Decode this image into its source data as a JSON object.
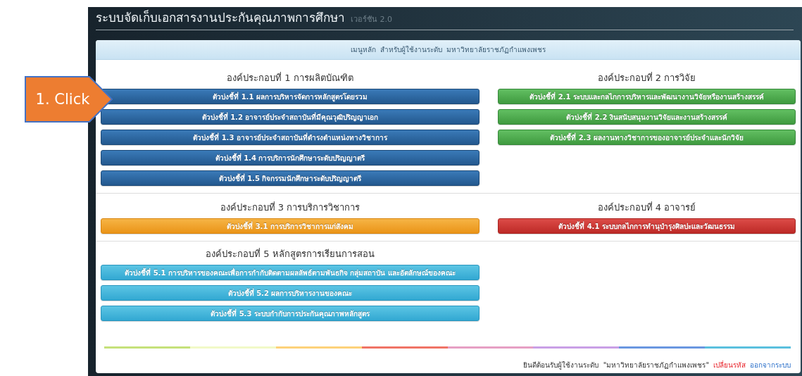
{
  "window": {
    "title": "ระบบจัดเก็บเอกสารงานประกันคุณภาพการศึกษา",
    "version": "เวอร์ชัน 2.0"
  },
  "menu_header": "เมนูหลัก  สำหรับผู้ใช้งานระดับ  มหาวิทยาลัยราชภัฏกำแพงเพชร",
  "sections": [
    {
      "title": "องค์ประกอบที่ 1 การผลิตบัณฑิต",
      "kind": "primary",
      "buttons": [
        "ตัวบ่งชี้ที่ 1.1 ผลการบริหารจัดการหลักสูตรโดยรวม",
        "ตัวบ่งชี้ที่ 1.2 อาจารย์ประจำสถาบันที่มีคุณวุฒิปริญญาเอก",
        "ตัวบ่งชี้ที่ 1.3 อาจารย์ประจำสถาบันที่ดำรงตำแหน่งทางวิชาการ",
        "ตัวบ่งชี้ที่ 1.4 การบริการนักศึกษาระดับปริญญาตรี",
        "ตัวบ่งชี้ที่ 1.5 กิจกรรมนักศึกษาระดับปริญญาตรี"
      ]
    },
    {
      "title": "องค์ประกอบที่ 2 การวิจัย",
      "kind": "success",
      "buttons": [
        "ตัวบ่งชี้ที่ 2.1 ระบบและกลไกการบริหารและพัฒนางานวิจัยหรืองานสร้างสรรค์",
        "ตัวบ่งชี้ที่ 2.2 งินสนับสนุนงานวิจัยและงานสร้างสรรค์",
        "ตัวบ่งชี้ที่ 2.3 ผลงานทางวิชาการของอาจารย์ประจำและนักวิจัย"
      ]
    },
    {
      "title": "องค์ประกอบที่ 3 การบริการวิชาการ",
      "kind": "warning",
      "buttons": [
        "ตัวบ่งชี้ที่ 3.1 การบริการวิชาการแก่สังคม"
      ]
    },
    {
      "title": "องค์ประกอบที่ 4 อาจารย์",
      "kind": "danger",
      "buttons": [
        "ตัวบ่งชี้ที่ 4.1 ระบบกลไกการทำนุบำรุงศิลปะและวัฒนธรรม"
      ]
    },
    {
      "title": "องค์ประกอบที่ 5 หลักสูตรการเรียนการสอน",
      "kind": "info",
      "buttons": [
        "ตัวบ่งชี้ที่ 5.1 การบริหารของคณะเพื่อการกำกับติดตามผลลัพธ์ตามพันธกิจ กลุ่มสถาบัน และอัตลักษณ์ของคณะ",
        "ตัวบ่งชี้ที่ 5.2 ผลการบริหารงานของคณะ",
        "ตัวบ่งชี้ที่ 5.3 ระบบกำกับการประกันคุณภาพหลักสูตร"
      ]
    }
  ],
  "footer": {
    "welcome": "ยินดีต้อนรับผู้ใช้งานระดับ  \"มหาวิทยาลัยราชภัฏกำแพงเพชร\"",
    "change_password": "เปลี่ยนรหัส",
    "logout": "ออกจากระบบ"
  },
  "callout": {
    "label": "1. Click"
  }
}
